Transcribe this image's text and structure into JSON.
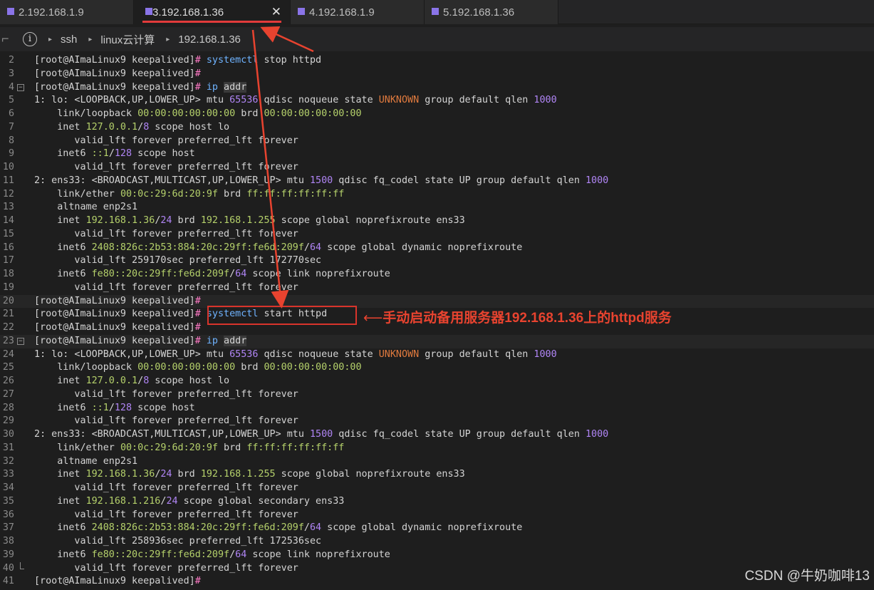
{
  "tabs": [
    {
      "label": "2.192.168.1.9",
      "active": false
    },
    {
      "label": "3.192.168.1.36",
      "active": true
    },
    {
      "label": "4.192.168.1.9",
      "active": false
    },
    {
      "label": "5.192.168.1.36",
      "active": false
    }
  ],
  "breadcrumb": [
    "ssh",
    "linux云计算",
    "192.168.1.36"
  ],
  "prompt": "[root@AImaLinux9 keepalived]#",
  "annotation": {
    "pre": "手动启动备用服务器",
    "ip": "192.168.1.36",
    "mid": "上的",
    "svc": "httpd",
    "post": "服务"
  },
  "watermark": "CSDN @牛奶咖啡13",
  "colors": {
    "accent": "#e23b3b",
    "tab_square": "#8a74e8"
  },
  "lines": [
    {
      "n": "2",
      "spans": [
        [
          "[root@AImaLinux9 keepalived]",
          "p"
        ],
        [
          "#",
          "pink"
        ],
        [
          " ",
          ""
        ],
        [
          "systemctl",
          "cmd"
        ],
        [
          " stop httpd",
          ""
        ]
      ]
    },
    {
      "n": "3",
      "spans": [
        [
          "[root@AImaLinux9 keepalived]",
          "p"
        ],
        [
          "#",
          "pink"
        ]
      ]
    },
    {
      "n": "4",
      "fold": "-",
      "spans": [
        [
          "[root@AImaLinux9 keepalived]",
          "p"
        ],
        [
          "#",
          "pink"
        ],
        [
          " ",
          ""
        ],
        [
          "ip",
          "cmd"
        ],
        [
          " ",
          ""
        ],
        [
          "addr",
          "arg"
        ]
      ]
    },
    {
      "n": "5",
      "spans": [
        [
          "1",
          ""
        ],
        [
          ":",
          ""
        ],
        [
          " lo: <LOOPBACK,UP,LOWER_UP> mtu ",
          ""
        ],
        [
          "65536",
          "num"
        ],
        [
          " qdisc noqueue state ",
          ""
        ],
        [
          "UNKNOWN",
          "org"
        ],
        [
          " group default qlen ",
          ""
        ],
        [
          "1000",
          "num"
        ]
      ]
    },
    {
      "n": "6",
      "spans": [
        [
          "    link/loopback ",
          ""
        ],
        [
          "00:00:00:00:00:00",
          "grn"
        ],
        [
          " brd ",
          ""
        ],
        [
          "00:00:00:00:00:00",
          "grn"
        ]
      ]
    },
    {
      "n": "7",
      "spans": [
        [
          "    inet ",
          ""
        ],
        [
          "127.0.0.1",
          "grn"
        ],
        [
          "/",
          ""
        ],
        [
          "8",
          "num"
        ],
        [
          " scope host lo",
          ""
        ]
      ]
    },
    {
      "n": "8",
      "spans": [
        [
          "       valid_lft forever preferred_lft forever",
          ""
        ]
      ]
    },
    {
      "n": "9",
      "spans": [
        [
          "    inet6 ",
          ""
        ],
        [
          "::1",
          "grn"
        ],
        [
          "/",
          ""
        ],
        [
          "128",
          "num"
        ],
        [
          " scope host",
          ""
        ]
      ]
    },
    {
      "n": "10",
      "spans": [
        [
          "       valid_lft forever preferred_lft forever",
          ""
        ]
      ]
    },
    {
      "n": "11",
      "spans": [
        [
          "2",
          ""
        ],
        [
          ":",
          ""
        ],
        [
          " ens33: <BROADCAST,MULTICAST,UP,LOWER_UP> mtu ",
          ""
        ],
        [
          "1500",
          "num"
        ],
        [
          " qdisc fq_codel state UP group default qlen ",
          ""
        ],
        [
          "1000",
          "num"
        ]
      ]
    },
    {
      "n": "12",
      "spans": [
        [
          "    link/ether ",
          ""
        ],
        [
          "00:0c:29:6d:20:9f",
          "grn"
        ],
        [
          " brd ",
          ""
        ],
        [
          "ff:ff:ff:ff:ff:ff",
          "grn"
        ]
      ]
    },
    {
      "n": "13",
      "spans": [
        [
          "    altname enp2s1",
          ""
        ]
      ]
    },
    {
      "n": "14",
      "spans": [
        [
          "    inet ",
          ""
        ],
        [
          "192.168.1.36",
          "grn"
        ],
        [
          "/",
          ""
        ],
        [
          "24",
          "num"
        ],
        [
          " brd ",
          ""
        ],
        [
          "192.168.1.255",
          "grn"
        ],
        [
          " scope global noprefixroute ens33",
          ""
        ]
      ]
    },
    {
      "n": "15",
      "spans": [
        [
          "       valid_lft forever preferred_lft forever",
          ""
        ]
      ]
    },
    {
      "n": "16",
      "spans": [
        [
          "    inet6 ",
          ""
        ],
        [
          "2408:826c:2b53:884:20c:29ff:fe6d:209f",
          "grn"
        ],
        [
          "/",
          ""
        ],
        [
          "64",
          "num"
        ],
        [
          " scope global dynamic noprefixroute",
          ""
        ]
      ]
    },
    {
      "n": "17",
      "spans": [
        [
          "       valid_lft 259170sec preferred_lft 172770sec",
          ""
        ]
      ]
    },
    {
      "n": "18",
      "spans": [
        [
          "    inet6 ",
          ""
        ],
        [
          "fe80::20c:29ff:fe6d:209f",
          "grn"
        ],
        [
          "/",
          ""
        ],
        [
          "64",
          "num"
        ],
        [
          " scope link noprefixroute",
          ""
        ]
      ]
    },
    {
      "n": "19",
      "spans": [
        [
          "       valid_lft forever preferred_lft forever",
          ""
        ]
      ]
    },
    {
      "n": "20",
      "hl": true,
      "spans": [
        [
          "[root@AImaLinux9 keepalived]",
          "p"
        ],
        [
          "#",
          "pink"
        ]
      ]
    },
    {
      "n": "21",
      "spans": [
        [
          "[root@AImaLinux9 keepalived]",
          "p"
        ],
        [
          "#",
          "pink"
        ],
        [
          " ",
          ""
        ],
        [
          "systemctl",
          "cmd"
        ],
        [
          " start httpd",
          ""
        ]
      ]
    },
    {
      "n": "22",
      "spans": [
        [
          "[root@AImaLinux9 keepalived]",
          "p"
        ],
        [
          "#",
          "pink"
        ]
      ]
    },
    {
      "n": "23",
      "fold": "-",
      "hl": true,
      "spans": [
        [
          "[root@AImaLinux9 keepalived]",
          "p"
        ],
        [
          "#",
          "pink"
        ],
        [
          " ",
          ""
        ],
        [
          "ip",
          "cmd"
        ],
        [
          " ",
          ""
        ],
        [
          "addr",
          "arg"
        ]
      ]
    },
    {
      "n": "24",
      "spans": [
        [
          "1",
          ""
        ],
        [
          ":",
          ""
        ],
        [
          " lo: <LOOPBACK,UP,LOWER_UP> mtu ",
          ""
        ],
        [
          "65536",
          "num"
        ],
        [
          " qdisc noqueue state ",
          ""
        ],
        [
          "UNKNOWN",
          "org"
        ],
        [
          " group default qlen ",
          ""
        ],
        [
          "1000",
          "num"
        ]
      ]
    },
    {
      "n": "25",
      "spans": [
        [
          "    link/loopback ",
          ""
        ],
        [
          "00:00:00:00:00:00",
          "grn"
        ],
        [
          " brd ",
          ""
        ],
        [
          "00:00:00:00:00:00",
          "grn"
        ]
      ]
    },
    {
      "n": "26",
      "spans": [
        [
          "    inet ",
          ""
        ],
        [
          "127.0.0.1",
          "grn"
        ],
        [
          "/",
          ""
        ],
        [
          "8",
          "num"
        ],
        [
          " scope host lo",
          ""
        ]
      ]
    },
    {
      "n": "27",
      "spans": [
        [
          "       valid_lft forever preferred_lft forever",
          ""
        ]
      ]
    },
    {
      "n": "28",
      "spans": [
        [
          "    inet6 ",
          ""
        ],
        [
          "::1",
          "grn"
        ],
        [
          "/",
          ""
        ],
        [
          "128",
          "num"
        ],
        [
          " scope host",
          ""
        ]
      ]
    },
    {
      "n": "29",
      "spans": [
        [
          "       valid_lft forever preferred_lft forever",
          ""
        ]
      ]
    },
    {
      "n": "30",
      "spans": [
        [
          "2",
          ""
        ],
        [
          ":",
          ""
        ],
        [
          " ens33: <BROADCAST,MULTICAST,UP,LOWER_UP> mtu ",
          ""
        ],
        [
          "1500",
          "num"
        ],
        [
          " qdisc fq_codel state UP group default qlen ",
          ""
        ],
        [
          "1000",
          "num"
        ]
      ]
    },
    {
      "n": "31",
      "spans": [
        [
          "    link/ether ",
          ""
        ],
        [
          "00:0c:29:6d:20:9f",
          "grn"
        ],
        [
          " brd ",
          ""
        ],
        [
          "ff:ff:ff:ff:ff:ff",
          "grn"
        ]
      ]
    },
    {
      "n": "32",
      "spans": [
        [
          "    altname enp2s1",
          ""
        ]
      ]
    },
    {
      "n": "33",
      "spans": [
        [
          "    inet ",
          ""
        ],
        [
          "192.168.1.36",
          "grn"
        ],
        [
          "/",
          ""
        ],
        [
          "24",
          "num"
        ],
        [
          " brd ",
          ""
        ],
        [
          "192.168.1.255",
          "grn"
        ],
        [
          " scope global noprefixroute ens33",
          ""
        ]
      ]
    },
    {
      "n": "34",
      "spans": [
        [
          "       valid_lft forever preferred_lft forever",
          ""
        ]
      ]
    },
    {
      "n": "35",
      "spans": [
        [
          "    inet ",
          ""
        ],
        [
          "192.168.1.216",
          "grn"
        ],
        [
          "/",
          ""
        ],
        [
          "24",
          "num"
        ],
        [
          " scope global secondary ens33",
          ""
        ]
      ]
    },
    {
      "n": "36",
      "spans": [
        [
          "       valid_lft forever preferred_lft forever",
          ""
        ]
      ]
    },
    {
      "n": "37",
      "spans": [
        [
          "    inet6 ",
          ""
        ],
        [
          "2408:826c:2b53:884:20c:29ff:fe6d:209f",
          "grn"
        ],
        [
          "/",
          ""
        ],
        [
          "64",
          "num"
        ],
        [
          " scope global dynamic noprefixroute",
          ""
        ]
      ]
    },
    {
      "n": "38",
      "spans": [
        [
          "       valid_lft 258936sec preferred_lft 172536sec",
          ""
        ]
      ]
    },
    {
      "n": "39",
      "spans": [
        [
          "    inet6 ",
          ""
        ],
        [
          "fe80::20c:29ff:fe6d:209f",
          "grn"
        ],
        [
          "/",
          ""
        ],
        [
          "64",
          "num"
        ],
        [
          " scope link noprefixroute",
          ""
        ]
      ]
    },
    {
      "n": "40",
      "fold": "L",
      "spans": [
        [
          "       valid_lft forever preferred_lft forever",
          ""
        ]
      ]
    },
    {
      "n": "41",
      "spans": [
        [
          "[root@AImaLinux9 keepalived]",
          "p"
        ],
        [
          "#",
          "pink"
        ]
      ]
    }
  ]
}
